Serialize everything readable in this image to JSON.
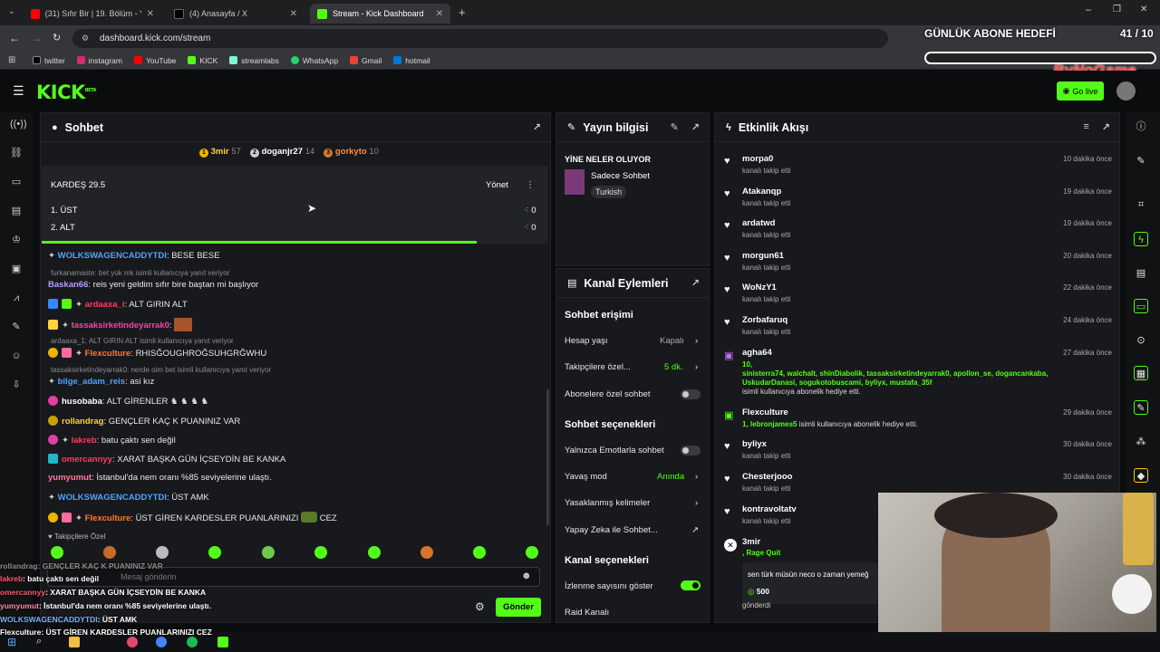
{
  "browser": {
    "tabs": [
      {
        "label": "(31) Sıfır Bir | 19. Bölüm - YouTube",
        "color": "#ff0000"
      },
      {
        "label": "(4) Anasayfa / X",
        "color": "#000000"
      },
      {
        "label": "Stream - Kick Dashboard",
        "color": "#53fc18"
      }
    ],
    "new_tab": "+",
    "url": "dashboard.kick.com/stream",
    "bookmarks": [
      "twitter",
      "instagram",
      "YouTube",
      "KICK",
      "streamlabs",
      "WhatsApp",
      "Gmail",
      "hotmail"
    ]
  },
  "overlay_top": {
    "title": "GÜNLÜK ABONE HEDEFİ",
    "count": "41 / 10",
    "brand": "ByNoGame"
  },
  "kick": {
    "logo": "KICK",
    "beta": "BETA",
    "go_live": "Go live"
  },
  "chat": {
    "title": "Sohbet",
    "leaders": [
      {
        "name": "3mir",
        "score": "57",
        "rank": "1"
      },
      {
        "name": "doganjr27",
        "score": "14",
        "rank": "2"
      },
      {
        "name": "gorkyto",
        "score": "10",
        "rank": "3"
      }
    ],
    "poll": {
      "title": "KARDEŞ 29.5",
      "manage": "Yönet",
      "options": [
        {
          "label": "1. ÜST",
          "votes": "0"
        },
        {
          "label": "2. ALT",
          "votes": "0"
        }
      ]
    },
    "messages": [
      {
        "user": "WOLKSWAGENCADDYTDI",
        "text": ": BESE BESE",
        "color": "#4ea3ff"
      },
      {
        "reply": "furkanamaste: bet yok mk isimli kullanıcıya yanıt veriyor"
      },
      {
        "user": "Baskan66",
        "text": ": reis yeni geldim sıfır bire baştan mi başlıyor",
        "color": "#b69bff"
      },
      {
        "user": "ardaaxa_i",
        "text": ": ALT GIRIN ALT",
        "color": "#ff3b5c"
      },
      {
        "user": "tassaksirketindeyarrak0",
        "text": ":",
        "color": "#ff3ea5"
      },
      {
        "reply": "ardaaxa_1: ALT GIRIN ALT isimli kullanıcıya yanıt veriyor"
      },
      {
        "user": "Flexculture",
        "text": ": RHISĞOUGHROĞSUHGRĞWHU",
        "color": "#ff7a2f"
      },
      {
        "reply": "tassaksirketindeyarrak0: nerde oim bet isimli kullanıcıya yanıt veriyor"
      },
      {
        "user": "bilge_adam_reis",
        "text": ": asi kız",
        "color": "#4ea3ff"
      },
      {
        "user": "husobaba",
        "text": ": ALT GİRENLER",
        "color": "#ffffff"
      },
      {
        "user": "rollandrag",
        "text": ": GENÇLER KAÇ K PUANINIZ VAR",
        "color": "#ffd23f"
      },
      {
        "user": "lakreb",
        "text": ": batu çaktı sen değil",
        "color": "#ff3b5c"
      },
      {
        "user": "omercannyy",
        "text": ": XARAT BAŞKA GÜN İÇSEYDİN BE KANKA",
        "color": "#ff3b5c"
      },
      {
        "user": "yumyumut",
        "text": ": İstanbul'da nem oranı %85 seviyelerine ulaştı.",
        "color": "#ff7a9c"
      },
      {
        "user": "WOLKSWAGENCADDYTDI",
        "text": ": ÜST AMK",
        "color": "#4ea3ff"
      },
      {
        "user": "Flexculture",
        "text": ": ÜST GİREN KARDESLER PUANLARINIZI",
        "color": "#ff7a2f",
        "tail": "CEZ"
      }
    ],
    "followers_only": "Takipçilere Özel",
    "input_placeholder": "Mesaj gönderin",
    "send": "Gönder"
  },
  "stream_info": {
    "title": "Yayın bilgisi",
    "stream_title": "YİNE NELER OLUYOR",
    "category": "Sadece Sohbet",
    "language": "Turkish"
  },
  "channel_actions": {
    "title": "Kanal Eylemleri",
    "chat_access": "Sohbet erişimi",
    "account_age": {
      "label": "Hesap yaşı",
      "value": "Kapalı"
    },
    "followers_only": {
      "label": "Takipçilere özel...",
      "value": "5 dk."
    },
    "subs_only": "Abonelere özel sohbet",
    "chat_options": "Sohbet seçenekleri",
    "emotes_only": "Yalnızca Emotlarla sohbet",
    "slow_mode": {
      "label": "Yavaş mod",
      "value": "Anında"
    },
    "banned_words": "Yasaklanmış kelimeler",
    "ai": "Yapay Zeka ile Sohbet...",
    "channel_options": "Kanal seçenekleri",
    "show_viewers": "İzlenme sayısını göster",
    "raid": "Raid Kanalı"
  },
  "activity": {
    "title": "Etkinlik Akışı",
    "events": [
      {
        "user": "morpa0",
        "sub": "kanalı takip etti",
        "time": "10 dakika önce"
      },
      {
        "user": "Atakanqp",
        "sub": "kanalı takip etti",
        "time": "19 dakika önce"
      },
      {
        "user": "ardatwd",
        "sub": "kanalı takip etti",
        "time": "19 dakika önce"
      },
      {
        "user": "morgun61",
        "sub": "kanalı takip etti",
        "time": "20 dakika önce"
      },
      {
        "user": "WoNzY1",
        "sub": "kanalı takip etti",
        "time": "22 dakika önce"
      },
      {
        "user": "Zorbafaruq",
        "sub": "kanalı takip etti",
        "time": "24 dakika önce"
      }
    ],
    "gift1": {
      "user": "agha64",
      "time": "27 dakika önce",
      "count": "10,",
      "names1": "sinisterra74, walchalt, shinDiabolik, tassaksirketindeyarrak0, apollon_se, dogancankaba,",
      "names2": "UskudarDanasi, sogukotobuscami, byliyx, mustafa_35f",
      "tail": "isimli kullanıcıya abonelik hediye etti."
    },
    "gift2": {
      "user": "Flexculture",
      "time": "29 dakika önce",
      "who": "1, lebronjames5",
      "tail": "isimli kullanıcıya abonelik hediye etti."
    },
    "events2": [
      {
        "user": "byliyx",
        "sub": "kanalı takip etti",
        "time": "30 dakika önce"
      },
      {
        "user": "Chesterjooo",
        "sub": "kanalı takip etti",
        "time": "30 dakika önce"
      },
      {
        "user": "kontravoltatv",
        "sub": "kanalı takip etti",
        "time": ""
      }
    ],
    "tip": {
      "user": "3mir",
      "tag": "Rage Quit",
      "msg": "sen türk müsün neco o zaman yemeğ",
      "amount": "500",
      "sent": "gönderdi"
    }
  },
  "overlay_chat": [
    {
      "user": "rollandrag",
      "text": ": GENÇLER KAÇ K PUANINIZ VAR",
      "color": "#8c8c8c"
    },
    {
      "user": "lakreb",
      "text": ": batu çaktı sen değil",
      "color": "#ff5a70"
    },
    {
      "user": "omercannyy",
      "text": ": XARAT BAŞKA GÜN İÇSEYDİN BE KANKA",
      "color": "#ff5a70"
    },
    {
      "user": "yumyumut",
      "text": ": İstanbul'da nem oranı %85 seviyelerine ulaştı.",
      "color": "#ff8aa5"
    },
    {
      "user": "WOLKSWAGENCADDYTDI",
      "text": ": ÜST AMK",
      "color": "#6fb4ff"
    },
    {
      "user": "Flexculture",
      "text": ": ÜST GİREN KARDESLER PUANLARINIZI",
      "color": "#ffffff",
      "tail": "CEZ"
    }
  ],
  "colors": {
    "accent": "#53fc18",
    "bg": "#0b0c0e",
    "panel": "#18191c"
  }
}
